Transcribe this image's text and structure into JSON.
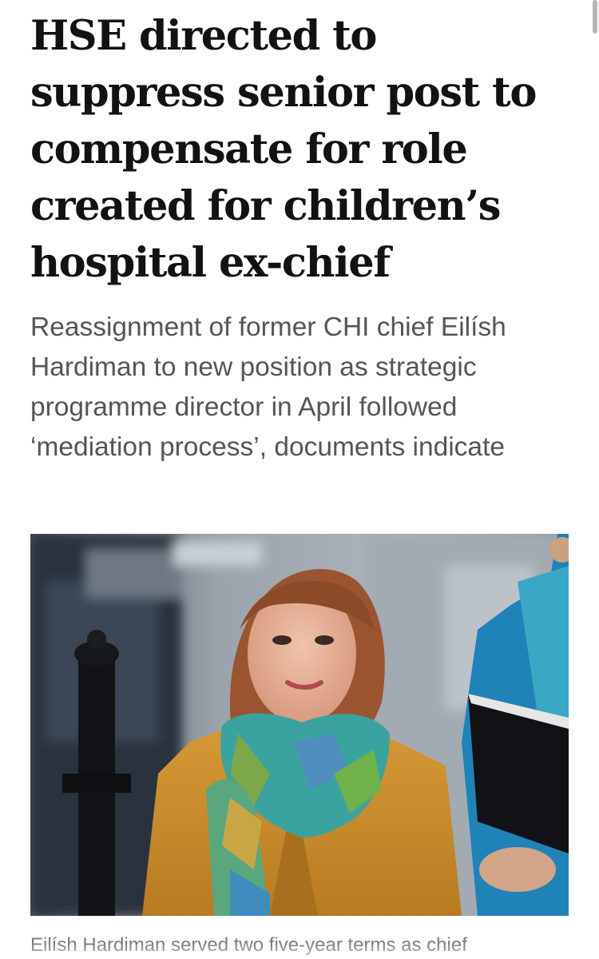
{
  "article": {
    "headline": "HSE directed to suppress senior post to compensate for role created for children’s hospital ex-chief",
    "standfirst": "Reassignment of former CHI chief Eilísh Hardiman to new position as strategic programme director in April followed ‘mediation process’, documents indicate",
    "caption": "Eilísh Hardiman served two five-year terms as chief"
  },
  "photo": {
    "subject": "woman with auburn bob haircut, mustard coat and multicoloured scarf walking outdoors"
  },
  "colors": {
    "headline": "#121212",
    "standfirst": "#555555",
    "caption": "#7b7b7b",
    "coat": "#c98b2a",
    "hair": "#9a5530"
  }
}
